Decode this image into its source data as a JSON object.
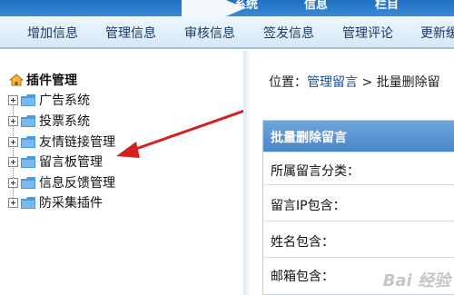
{
  "top_tabs": [
    "系统",
    "信息",
    "栏目"
  ],
  "menu": [
    "增加信息",
    "管理信息",
    "审核信息",
    "签发信息",
    "管理评论",
    "更新缓"
  ],
  "tree": {
    "title": "插件管理",
    "items": [
      "广告系统",
      "投票系统",
      "友情链接管理",
      "留言板管理",
      "信息反馈管理",
      "防采集插件"
    ]
  },
  "breadcrumb": {
    "prefix": "位置：",
    "link": "管理留言",
    "sep": " > ",
    "current": "批量删除留"
  },
  "form": {
    "header": "批量删除留言",
    "rows": [
      "所属留言分类：",
      "留言IP包含：",
      "姓名包含：",
      "邮箱包含："
    ]
  },
  "watermark": "Bai 经验",
  "colors": {
    "accent_blue": "#1f6fc2",
    "arrow_red": "#d42020",
    "link_blue": "#1a4f99"
  }
}
